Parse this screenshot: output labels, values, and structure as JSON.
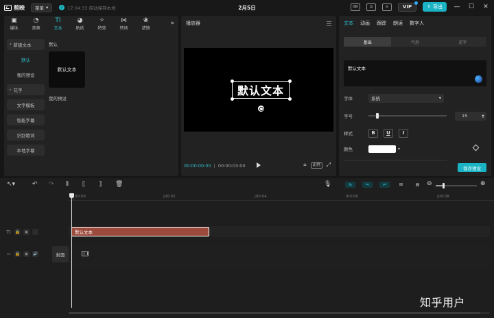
{
  "app": {
    "logo_text": "剪映",
    "menu_label": "菜单",
    "autosave_text": "17:04:33 自动保存本地",
    "document_title": "2月5日",
    "vip_label": "VIP",
    "export_label": "导出",
    "accent_color": "#2ec5d3"
  },
  "media_tabs": [
    {
      "icon": "media-icon",
      "glyph": "▣",
      "label": "媒体"
    },
    {
      "icon": "audio-icon",
      "glyph": "◔",
      "label": "音频"
    },
    {
      "icon": "text-icon",
      "glyph": "TI",
      "label": "文本"
    },
    {
      "icon": "sticker-icon",
      "glyph": "◕",
      "label": "贴纸"
    },
    {
      "icon": "effects-icon",
      "glyph": "✧",
      "label": "特效"
    },
    {
      "icon": "transition-icon",
      "glyph": "⋈",
      "label": "转场"
    },
    {
      "icon": "filter-icon",
      "glyph": "❀",
      "label": "滤镜"
    }
  ],
  "media_more": "»",
  "text_categories": {
    "new_text": "新建文本",
    "default": "默认",
    "my_presets": "我的预设",
    "flower_text": "花字",
    "text_template": "文字模板",
    "smart_subtitle": "智能字幕",
    "recognize_lyrics": "识别歌词",
    "local_subtitle": "本地字幕"
  },
  "text_library": {
    "default_section": "默认",
    "default_preset_text": "默认文本",
    "my_presets_section": "我的预设"
  },
  "player": {
    "title": "播放器",
    "canvas_text": "默认文本",
    "current_time": "00:00:00:00",
    "duration": "00:00:03:00",
    "ratio_label": "比例"
  },
  "properties": {
    "tabs": [
      "文本",
      "动画",
      "跟踪",
      "朗读",
      "数字人"
    ],
    "segments": [
      "基础",
      "气泡",
      "花字"
    ],
    "text_value": "默认文本",
    "font_label": "字体",
    "font_value": "系统",
    "size_label": "字号",
    "size_value": "15",
    "size_fraction": 0.1,
    "style_label": "样式",
    "bold": "B",
    "underline": "U",
    "italic": "I",
    "color_label": "颜色",
    "color_value": "#ffffff",
    "save_preset": "保存预设"
  },
  "timeline": {
    "ruler_ticks": [
      "00:00",
      "|00:02",
      "|00:04",
      "|00:06",
      "|00:08"
    ],
    "text_clip_label": "默认文本",
    "cover_label": "封面",
    "zoom_fraction": 0.17
  },
  "watermark": "知乎用户"
}
